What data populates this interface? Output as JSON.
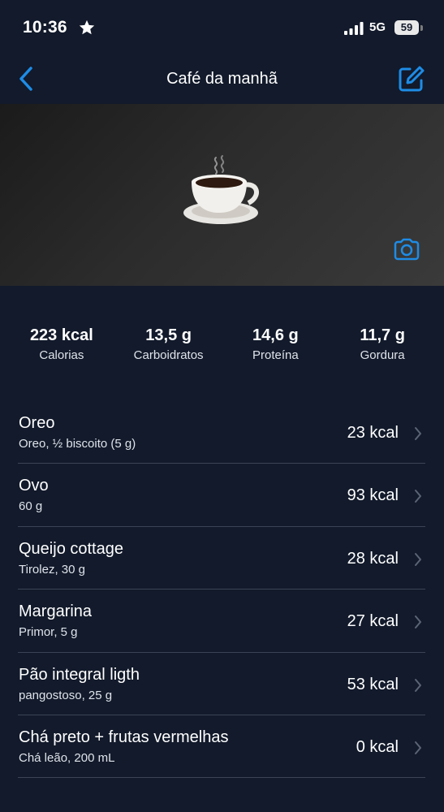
{
  "status": {
    "time": "10:36",
    "network": "5G",
    "battery": "59"
  },
  "nav": {
    "title": "Café da manhã"
  },
  "colors": {
    "accent": "#1e8ce6",
    "background": "#121a2b",
    "divider": "#3b4456"
  },
  "summary": {
    "calories": {
      "value": "223 kcal",
      "label": "Calorias"
    },
    "carbs": {
      "value": "13,5 g",
      "label": "Carboidratos"
    },
    "protein": {
      "value": "14,6 g",
      "label": "Proteína"
    },
    "fat": {
      "value": "11,7 g",
      "label": "Gordura"
    }
  },
  "foods": [
    {
      "name": "Oreo",
      "detail": "Oreo, ½ biscoito (5 g)",
      "kcal": "23 kcal"
    },
    {
      "name": "Ovo",
      "detail": "60 g",
      "kcal": "93 kcal"
    },
    {
      "name": "Queijo cottage",
      "detail": "Tirolez, 30 g",
      "kcal": "28 kcal"
    },
    {
      "name": "Margarina",
      "detail": "Primor, 5 g",
      "kcal": "27 kcal"
    },
    {
      "name": "Pão integral ligth",
      "detail": "pangostoso, 25 g",
      "kcal": "53 kcal"
    },
    {
      "name": "Chá preto + frutas vermelhas",
      "detail": "Chá leão, 200 mL",
      "kcal": "0 kcal"
    }
  ]
}
